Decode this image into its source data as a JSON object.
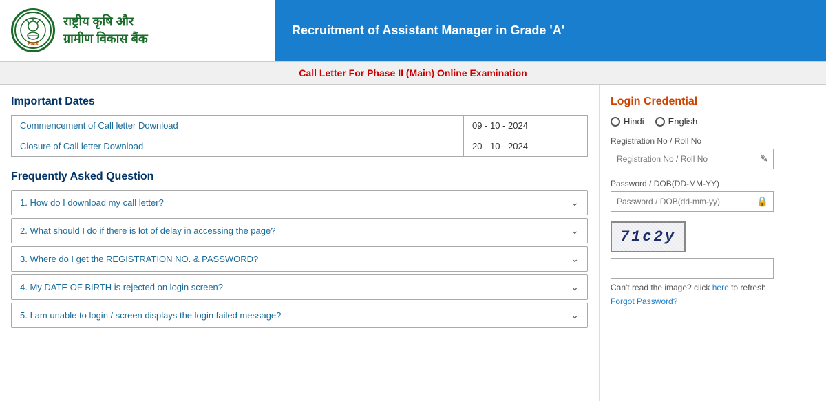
{
  "header": {
    "logo_text_line1": "राष्ट्रीय कृषि और",
    "logo_text_line2": "ग्रामीण विकास बैंक",
    "logo_nabard": "नाबार्ड",
    "title": "Recruitment of Assistant Manager in Grade 'A'"
  },
  "subheader": {
    "text": "Call Letter For Phase II (Main) Online Examination"
  },
  "important_dates": {
    "section_title": "Important Dates",
    "rows": [
      {
        "label": "Commencement of Call letter Download",
        "value": "09 - 10 - 2024"
      },
      {
        "label": "Closure of Call letter Download",
        "value": "20 - 10 - 2024"
      }
    ]
  },
  "faq": {
    "section_title": "Frequently Asked Question",
    "items": [
      {
        "text": "1. How do I download my call letter?"
      },
      {
        "text": "2. What should I do if there is lot of delay in accessing the page?"
      },
      {
        "text": "3. Where do I get the REGISTRATION NO. & PASSWORD?"
      },
      {
        "text": "4. My DATE OF BIRTH is rejected on login screen?"
      },
      {
        "text": "5. I am unable to login / screen displays the login failed message?"
      }
    ]
  },
  "login": {
    "title": "Login Credential",
    "lang_hindi": "Hindi",
    "lang_english": "English",
    "reg_label": "Registration No / Roll No",
    "reg_placeholder": "Registration No / Roll No",
    "pass_label": "Password / DOB(DD-MM-YY)",
    "pass_placeholder": "Password / DOB(dd-mm-yy)",
    "captcha_value": "71c2y",
    "captcha_refresh_text": "Can't read the image? click",
    "captcha_refresh_link": "here",
    "captcha_refresh_suffix": "to refresh.",
    "forgot_password": "Forgot Password?"
  }
}
